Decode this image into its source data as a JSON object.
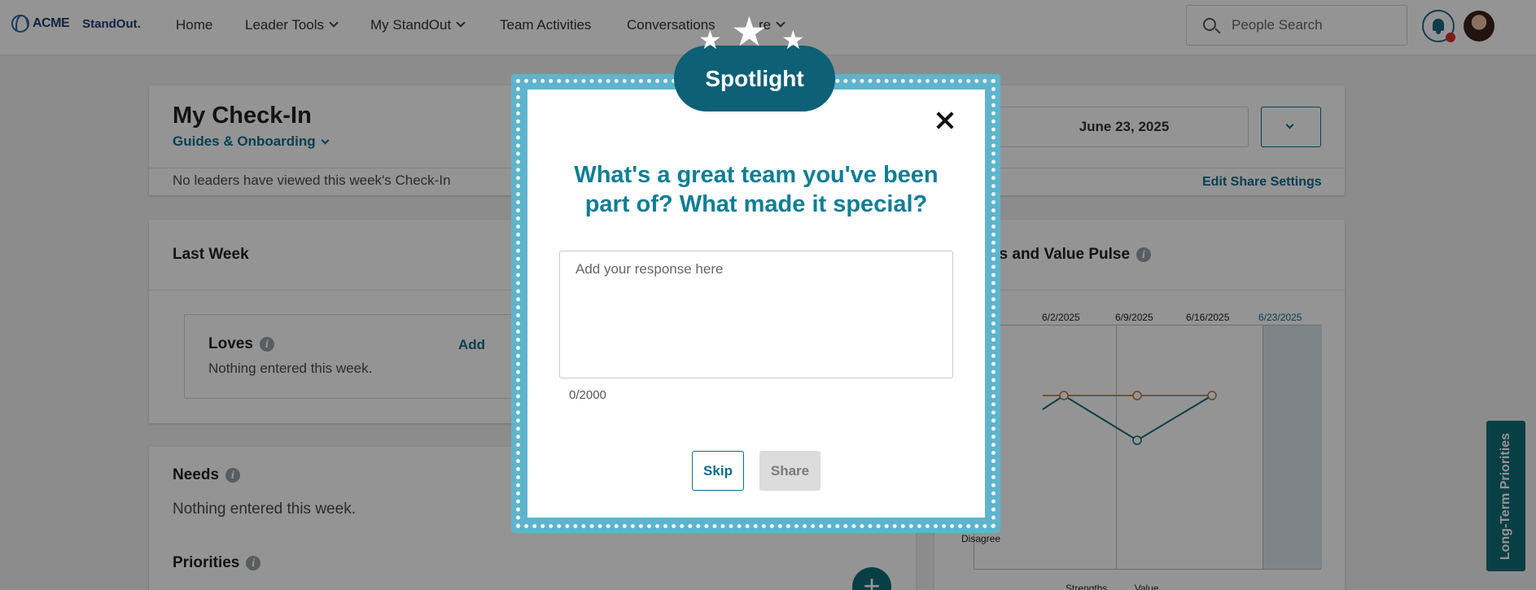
{
  "nav": {
    "logo_company": "ACME",
    "logo_product": "StandOut.",
    "items": [
      {
        "label": "Home"
      },
      {
        "label": "Leader Tools"
      },
      {
        "label": "My StandOut"
      },
      {
        "label": "Team Activities"
      },
      {
        "label": "Conversations"
      },
      {
        "label": "re"
      }
    ],
    "search_placeholder": "People Search"
  },
  "checkin": {
    "title": "My Check-In",
    "guides_label": "Guides & Onboarding",
    "viewed_note": "No leaders have viewed this week's Check-In",
    "date": "June 23, 2025",
    "edit_share": "Edit Share Settings"
  },
  "last_week": {
    "title": "Last Week",
    "loves_title": "Loves",
    "loves_add": "Add",
    "loves_empty": "Nothing entered this week."
  },
  "needs": {
    "title": "Needs",
    "empty": "Nothing entered this week."
  },
  "priorities": {
    "title": "Priorities"
  },
  "pulse": {
    "title": "gths and Value Pulse",
    "dates": [
      "6/2/2025",
      "6/9/2025",
      "6/16/2025",
      "6/23/2025"
    ],
    "y_bottom_label": "Disagree",
    "legend_strengths": "Strengths",
    "legend_value": "Value"
  },
  "side_tab": {
    "label": "Long-Term Priorities"
  },
  "fab_label": "+",
  "modal": {
    "badge": "Spotlight",
    "question": "What's a great team you've been part of? What made it special?",
    "placeholder": "Add your response here",
    "counter": "0/2000",
    "skip": "Skip",
    "share": "Share"
  },
  "colors": {
    "brand_teal": "#0e6d8a",
    "spotlight_frame": "#5fb4cc",
    "strengths_line": "#0e6d78",
    "value_line": "#e0853a"
  }
}
